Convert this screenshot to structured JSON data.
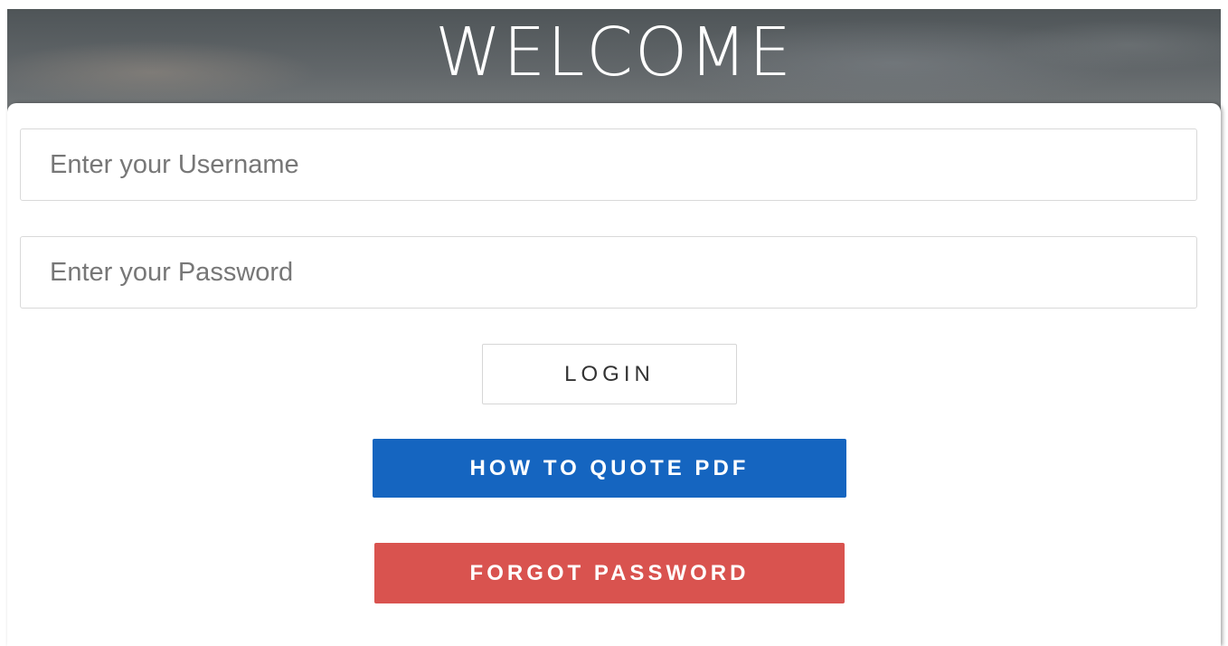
{
  "header": {
    "title": "WELCOME"
  },
  "form": {
    "username": {
      "value": "",
      "placeholder": "Enter your Username"
    },
    "password": {
      "value": "",
      "placeholder": "Enter your Password"
    }
  },
  "buttons": {
    "login_label": "LOGIN",
    "quote_pdf_label": "HOW TO QUOTE PDF",
    "forgot_password_label": "FORGOT PASSWORD"
  },
  "colors": {
    "quote_button": "#1565c0",
    "forgot_button": "#d9534f"
  }
}
